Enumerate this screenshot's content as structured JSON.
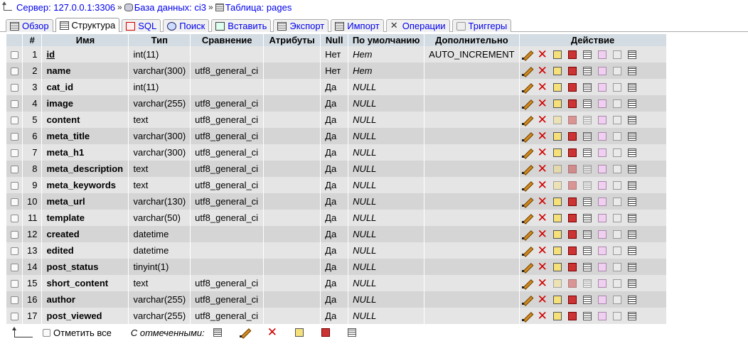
{
  "breadcrumb": {
    "server": "Сервер: 127.0.0.1:3306",
    "database": "База данных: ci3",
    "table": "Таблица: pages",
    "sep": "»"
  },
  "tabs": [
    {
      "label": "Обзор",
      "icon": "browse-icon",
      "active": false
    },
    {
      "label": "Структура",
      "icon": "structure-icon",
      "active": true
    },
    {
      "label": "SQL",
      "icon": "sql-icon",
      "active": false
    },
    {
      "label": "Поиск",
      "icon": "search-icon",
      "active": false
    },
    {
      "label": "Вставить",
      "icon": "insert-icon",
      "active": false
    },
    {
      "label": "Экспорт",
      "icon": "export-icon",
      "active": false
    },
    {
      "label": "Импорт",
      "icon": "import-icon",
      "active": false
    },
    {
      "label": "Операции",
      "icon": "operations-icon",
      "active": false
    },
    {
      "label": "Триггеры",
      "icon": "triggers-icon",
      "active": false
    }
  ],
  "columns": {
    "num": "#",
    "name": "Имя",
    "type": "Тип",
    "collation": "Сравнение",
    "attributes": "Атрибуты",
    "null": "Null",
    "default": "По умолчанию",
    "extra": "Дополнительно",
    "action": "Действие"
  },
  "rows": [
    {
      "num": "1",
      "name": "id",
      "type": "int(11)",
      "collation": "",
      "attributes": "",
      "null": "Нет",
      "default": "Нет",
      "extra": "AUTO_INCREMENT",
      "pk": true,
      "text_type": false
    },
    {
      "num": "2",
      "name": "name",
      "type": "varchar(300)",
      "collation": "utf8_general_ci",
      "attributes": "",
      "null": "Нет",
      "default": "Нет",
      "extra": "",
      "pk": false,
      "text_type": false
    },
    {
      "num": "3",
      "name": "cat_id",
      "type": "int(11)",
      "collation": "",
      "attributes": "",
      "null": "Да",
      "default": "NULL",
      "extra": "",
      "pk": false,
      "text_type": false
    },
    {
      "num": "4",
      "name": "image",
      "type": "varchar(255)",
      "collation": "utf8_general_ci",
      "attributes": "",
      "null": "Да",
      "default": "NULL",
      "extra": "",
      "pk": false,
      "text_type": false
    },
    {
      "num": "5",
      "name": "content",
      "type": "text",
      "collation": "utf8_general_ci",
      "attributes": "",
      "null": "Да",
      "default": "NULL",
      "extra": "",
      "pk": false,
      "text_type": true
    },
    {
      "num": "6",
      "name": "meta_title",
      "type": "varchar(300)",
      "collation": "utf8_general_ci",
      "attributes": "",
      "null": "Да",
      "default": "NULL",
      "extra": "",
      "pk": false,
      "text_type": false
    },
    {
      "num": "7",
      "name": "meta_h1",
      "type": "varchar(300)",
      "collation": "utf8_general_ci",
      "attributes": "",
      "null": "Да",
      "default": "NULL",
      "extra": "",
      "pk": false,
      "text_type": false
    },
    {
      "num": "8",
      "name": "meta_description",
      "type": "text",
      "collation": "utf8_general_ci",
      "attributes": "",
      "null": "Да",
      "default": "NULL",
      "extra": "",
      "pk": false,
      "text_type": true
    },
    {
      "num": "9",
      "name": "meta_keywords",
      "type": "text",
      "collation": "utf8_general_ci",
      "attributes": "",
      "null": "Да",
      "default": "NULL",
      "extra": "",
      "pk": false,
      "text_type": true
    },
    {
      "num": "10",
      "name": "meta_url",
      "type": "varchar(130)",
      "collation": "utf8_general_ci",
      "attributes": "",
      "null": "Да",
      "default": "NULL",
      "extra": "",
      "pk": false,
      "text_type": false
    },
    {
      "num": "11",
      "name": "template",
      "type": "varchar(50)",
      "collation": "utf8_general_ci",
      "attributes": "",
      "null": "Да",
      "default": "NULL",
      "extra": "",
      "pk": false,
      "text_type": false
    },
    {
      "num": "12",
      "name": "created",
      "type": "datetime",
      "collation": "",
      "attributes": "",
      "null": "Да",
      "default": "NULL",
      "extra": "",
      "pk": false,
      "text_type": false
    },
    {
      "num": "13",
      "name": "edited",
      "type": "datetime",
      "collation": "",
      "attributes": "",
      "null": "Да",
      "default": "NULL",
      "extra": "",
      "pk": false,
      "text_type": false
    },
    {
      "num": "14",
      "name": "post_status",
      "type": "tinyint(1)",
      "collation": "",
      "attributes": "",
      "null": "Да",
      "default": "NULL",
      "extra": "",
      "pk": false,
      "text_type": false
    },
    {
      "num": "15",
      "name": "short_content",
      "type": "text",
      "collation": "utf8_general_ci",
      "attributes": "",
      "null": "Да",
      "default": "NULL",
      "extra": "",
      "pk": false,
      "text_type": true
    },
    {
      "num": "16",
      "name": "author",
      "type": "varchar(255)",
      "collation": "utf8_general_ci",
      "attributes": "",
      "null": "Да",
      "default": "NULL",
      "extra": "",
      "pk": false,
      "text_type": false
    },
    {
      "num": "17",
      "name": "post_viewed",
      "type": "varchar(255)",
      "collation": "utf8_general_ci",
      "attributes": "",
      "null": "Да",
      "default": "NULL",
      "extra": "",
      "pk": false,
      "text_type": false
    }
  ],
  "footer": {
    "check_all": "Отметить все",
    "with_selected": "С отмеченными:"
  },
  "colors": {
    "header_bg": "#d3dce3",
    "row_odd": "#e5e5e5",
    "row_even": "#d5d5d5",
    "link": "#0000ee",
    "drop": "#d00000"
  }
}
